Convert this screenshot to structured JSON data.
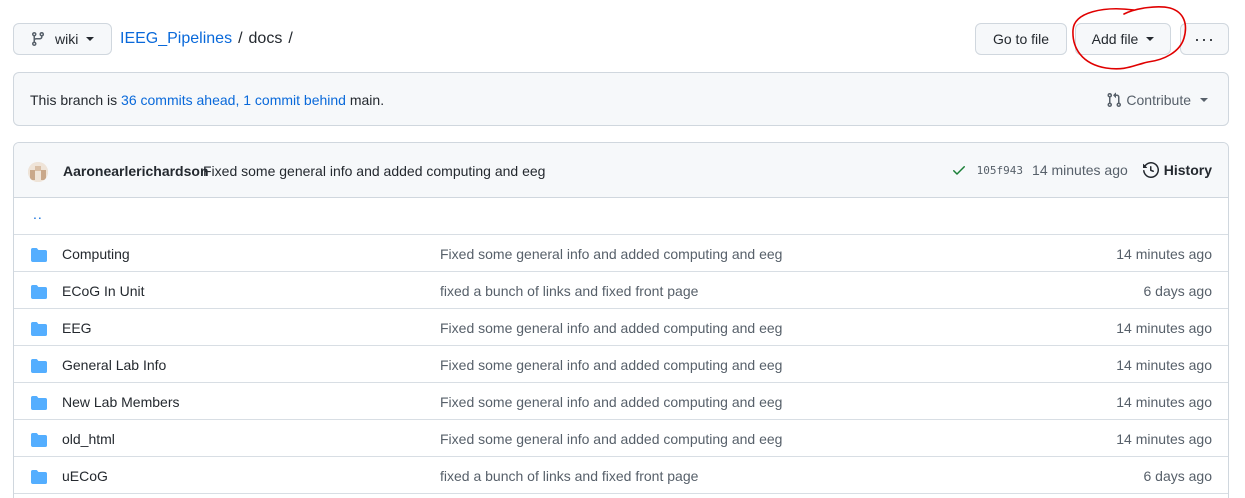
{
  "header": {
    "branch_label": "wiki",
    "breadcrumb": {
      "repo": "IEEG_Pipelines",
      "sep1": "/",
      "dir": "docs",
      "sep2": "/"
    },
    "go_to_file": "Go to file",
    "add_file": "Add file",
    "more": "···"
  },
  "banner": {
    "prefix": "This branch is ",
    "ahead": "36 commits ahead,",
    "behind": "1 commit behind",
    "suffix": " main.",
    "contribute": "Contribute"
  },
  "commit": {
    "author": "Aaronearlerichardson",
    "message": "Fixed some general info and added computing and eeg",
    "sha": "105f943",
    "time": "14 minutes ago",
    "history": "History"
  },
  "parent_dir": "..",
  "files": [
    {
      "name": "Computing",
      "message": "Fixed some general info and added computing and eeg",
      "age": "14 minutes ago"
    },
    {
      "name": "ECoG In Unit",
      "message": "fixed a bunch of links and fixed front page",
      "age": "6 days ago"
    },
    {
      "name": "EEG",
      "message": "Fixed some general info and added computing and eeg",
      "age": "14 minutes ago"
    },
    {
      "name": "General Lab Info",
      "message": "Fixed some general info and added computing and eeg",
      "age": "14 minutes ago"
    },
    {
      "name": "New Lab Members",
      "message": "Fixed some general info and added computing and eeg",
      "age": "14 minutes ago"
    },
    {
      "name": "old_html",
      "message": "Fixed some general info and added computing and eeg",
      "age": "14 minutes ago"
    },
    {
      "name": "uECoG",
      "message": "fixed a bunch of links and fixed front page",
      "age": "6 days ago"
    }
  ],
  "icons": {
    "branch": "git-branch-icon",
    "contribute": "git-pull-request-icon",
    "check": "check-icon",
    "history": "history-icon",
    "folder": "folder-icon"
  },
  "colors": {
    "link": "#0969da",
    "folder": "#54aeff",
    "success": "#1a7f37",
    "annotation": "#e00000"
  }
}
